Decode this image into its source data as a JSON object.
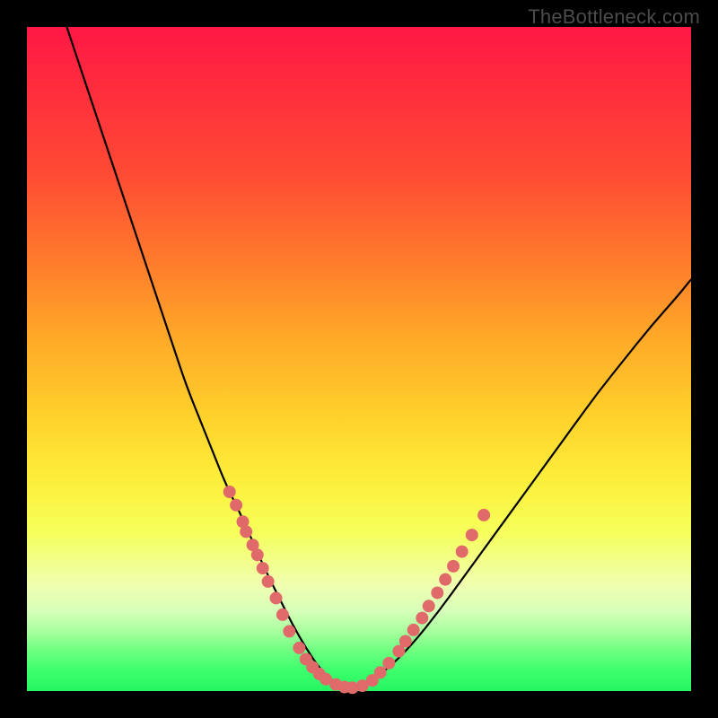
{
  "watermark": "TheBottleneck.com",
  "colors": {
    "curve_stroke": "#000000",
    "marker_fill": "#e06a6a",
    "marker_stroke": "#d45e5e"
  },
  "chart_data": {
    "type": "line",
    "title": "",
    "xlabel": "",
    "ylabel": "",
    "xlim": [
      0,
      100
    ],
    "ylim": [
      0,
      100
    ],
    "series": [
      {
        "name": "curve",
        "x": [
          6,
          8,
          10,
          12,
          14,
          16,
          18,
          20,
          22,
          24,
          26,
          28,
          30,
          32,
          34,
          36,
          38,
          40,
          42,
          44,
          46,
          48,
          50,
          54,
          58,
          62,
          66,
          70,
          74,
          78,
          82,
          86,
          90,
          94,
          98,
          100
        ],
        "y": [
          100,
          94,
          88,
          82,
          76,
          70,
          64,
          58,
          52,
          46,
          41,
          36,
          31,
          27,
          22.5,
          18,
          14,
          10,
          6.5,
          3.5,
          1.5,
          0.5,
          0.7,
          3,
          7,
          12,
          17.5,
          23,
          28.5,
          34,
          39.5,
          45,
          50,
          55,
          59.5,
          62
        ]
      }
    ],
    "markers": [
      {
        "x": 30.5,
        "y": 30
      },
      {
        "x": 31.5,
        "y": 28
      },
      {
        "x": 32.5,
        "y": 25.5
      },
      {
        "x": 33.0,
        "y": 24
      },
      {
        "x": 34.0,
        "y": 22
      },
      {
        "x": 34.7,
        "y": 20.5
      },
      {
        "x": 35.5,
        "y": 18.5
      },
      {
        "x": 36.3,
        "y": 16.5
      },
      {
        "x": 37.5,
        "y": 14
      },
      {
        "x": 38.5,
        "y": 11.5
      },
      {
        "x": 39.5,
        "y": 9
      },
      {
        "x": 41.0,
        "y": 6.5
      },
      {
        "x": 42.0,
        "y": 4.8
      },
      {
        "x": 43.0,
        "y": 3.6
      },
      {
        "x": 44.0,
        "y": 2.6
      },
      {
        "x": 45.0,
        "y": 1.8
      },
      {
        "x": 46.5,
        "y": 1.0
      },
      {
        "x": 47.8,
        "y": 0.6
      },
      {
        "x": 49.0,
        "y": 0.5
      },
      {
        "x": 50.5,
        "y": 0.8
      },
      {
        "x": 52.0,
        "y": 1.6
      },
      {
        "x": 53.2,
        "y": 2.8
      },
      {
        "x": 54.5,
        "y": 4.2
      },
      {
        "x": 56.0,
        "y": 6.0
      },
      {
        "x": 57.0,
        "y": 7.5
      },
      {
        "x": 58.2,
        "y": 9.2
      },
      {
        "x": 59.5,
        "y": 11.0
      },
      {
        "x": 60.5,
        "y": 12.8
      },
      {
        "x": 61.8,
        "y": 14.8
      },
      {
        "x": 63.0,
        "y": 16.8
      },
      {
        "x": 64.2,
        "y": 18.8
      },
      {
        "x": 65.5,
        "y": 21.0
      },
      {
        "x": 67.0,
        "y": 23.5
      },
      {
        "x": 68.8,
        "y": 26.5
      }
    ]
  }
}
